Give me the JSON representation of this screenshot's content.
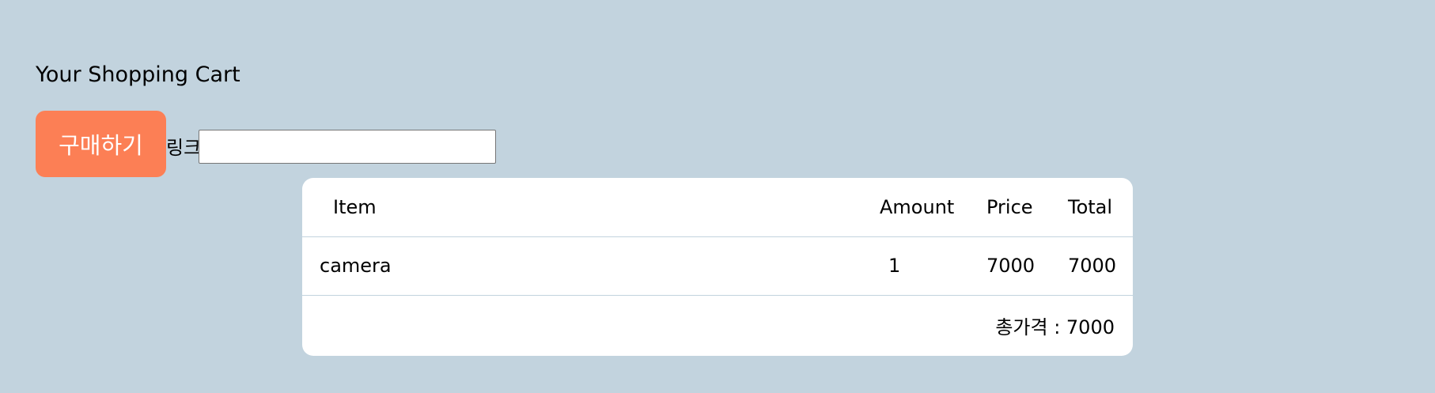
{
  "title": "Your Shopping Cart",
  "purchase_button_label": "구매하기",
  "link_label": "링크",
  "link_input": {
    "value": "",
    "placeholder": ""
  },
  "table": {
    "headers": {
      "item": "Item",
      "amount": "Amount",
      "price": "Price",
      "total": "Total"
    },
    "rows": [
      {
        "item": "camera",
        "amount": "1",
        "price": "7000",
        "total": "7000"
      }
    ],
    "total_text": "총가격 : 7000"
  },
  "colors": {
    "background": "#c2d3de",
    "button": "#fc7f55",
    "card": "#ffffff"
  }
}
